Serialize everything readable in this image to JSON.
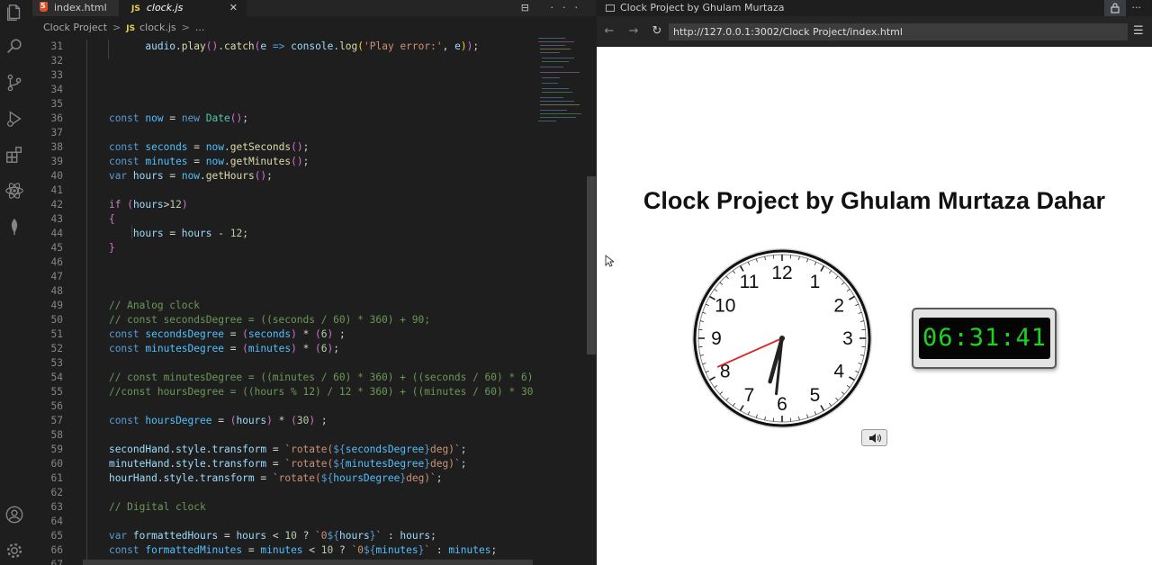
{
  "editor": {
    "tabs": [
      {
        "label": "index.html",
        "type": "html"
      },
      {
        "label": "clock.js",
        "type": "js"
      }
    ],
    "tab_close": "✕",
    "tab_actions": "⊟ ···",
    "breadcrumb": {
      "folder": "Clock Project",
      "file": "clock.js",
      "rest": "..."
    },
    "js_badge": "JS"
  },
  "browser": {
    "tab_title": "Clock Project by Ghulam Murtaza Dahar",
    "tab_close": "✕",
    "more": "···",
    "url": "http://127.0.0.1:3002/Clock Project/index.html",
    "back": "←",
    "forward": "→",
    "reload": "↻",
    "menu": "☰"
  },
  "page": {
    "title": "Clock Project by Ghulam Murtaza Dahar",
    "digital_time": "06:31:41",
    "clock_numbers": [
      "12",
      "1",
      "2",
      "3",
      "4",
      "5",
      "6",
      "7",
      "8",
      "9",
      "10",
      "11"
    ],
    "time": {
      "hours": 6,
      "minutes": 31,
      "seconds": 41
    }
  },
  "icons": {
    "activity": [
      "files-icon",
      "search-icon",
      "source-control-icon",
      "run-debug-icon",
      "extensions-icon",
      "react-icon",
      "mongodb-leaf-icon",
      "account-icon",
      "settings-gear-icon"
    ],
    "speaker": "speaker-icon"
  },
  "colors": {
    "editor_bg": "#1e1e1e",
    "keyword": "#569cd6",
    "control": "#c586c0",
    "variable": "#9cdcfe",
    "function": "#dcdcaa",
    "string": "#ce9178",
    "number": "#b5cea8",
    "comment": "#6a9955",
    "digital_text": "#1fd21f",
    "second_hand": "#e02020"
  }
}
